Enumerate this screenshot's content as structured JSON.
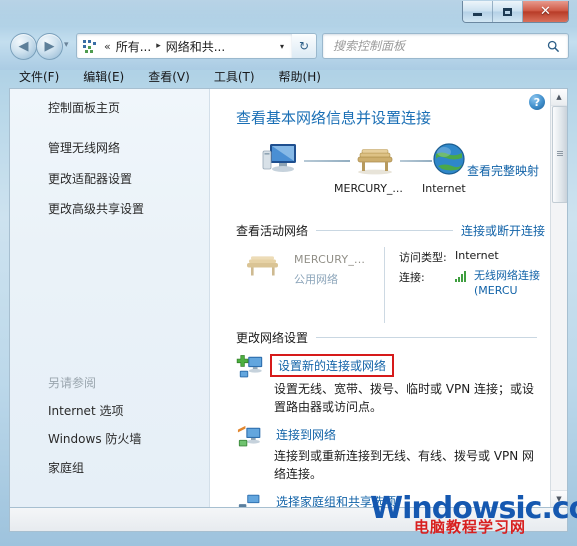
{
  "window": {
    "buttons": {
      "minimize": "–",
      "maximize": "□",
      "close": "✕"
    }
  },
  "nav": {
    "back_glyph": "◀",
    "forward_glyph": "▶",
    "dropdown_glyph": "▾",
    "breadcrumb": {
      "chevrons": "«",
      "crumb1": "所有...",
      "separator": "▸",
      "crumb2": "网络和共...",
      "caret": "▾"
    },
    "refresh_glyph": "↻"
  },
  "search": {
    "placeholder": "搜索控制面板",
    "value": ""
  },
  "menubar": {
    "items": [
      "文件(F)",
      "编辑(E)",
      "查看(V)",
      "工具(T)",
      "帮助(H)"
    ]
  },
  "sidebar": {
    "home": "控制面板主页",
    "items": [
      "管理无线网络",
      "更改适配器设置",
      "更改高级共享设置"
    ],
    "see_also_title": "另请参阅",
    "see_also": [
      "Internet 选项",
      "Windows 防火墙",
      "家庭组"
    ]
  },
  "content": {
    "help_glyph": "?",
    "heading": "查看基本网络信息并设置连接",
    "map": {
      "router_label": "MERCURY_...",
      "internet_label": "Internet",
      "view_full_map": "查看完整映射"
    },
    "active_networks": {
      "title": "查看活动网络",
      "link": "连接或断开连接",
      "ssid": "MERCURY_...",
      "network_type": "公用网络",
      "access_key": "访问类型:",
      "access_value": "Internet",
      "conn_key": "连接:",
      "conn_value": "无线网络连接 (MERCU"
    },
    "change_settings": {
      "title": "更改网络设置",
      "items": [
        {
          "title": "设置新的连接或网络",
          "desc": "设置无线、宽带、拨号、临时或 VPN 连接；或设置路由器或访问点。",
          "highlighted": true
        },
        {
          "title": "连接到网络",
          "desc": "连接到或重新连接到无线、有线、拨号或 VPN 网络连接。",
          "highlighted": false
        },
        {
          "title": "选择家庭组和共享选项",
          "desc": "",
          "highlighted": false
        }
      ]
    }
  },
  "scrollbar": {
    "up_glyph": "▲",
    "down_glyph": "▼"
  },
  "watermark": {
    "main": "Windowsic.com",
    "sub": "电脑教程学习网"
  },
  "colors": {
    "link": "#1263a8",
    "heading": "#1a6fb5",
    "highlight_border": "#d61a1a",
    "signal_green": "#3f9e3f",
    "watermark_blue": "#1558b0",
    "watermark_red": "#d81f1f"
  }
}
